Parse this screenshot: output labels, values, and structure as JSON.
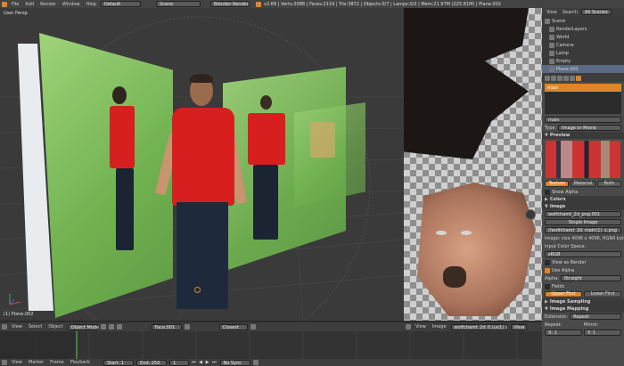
{
  "topbar": {
    "menus": [
      "File",
      "Add",
      "Render",
      "Window",
      "Help"
    ],
    "layout": "Default",
    "scene": "Scene",
    "engine": "Blender Render",
    "all_scenes": "All Scenes",
    "stats": "v2.69 | Verts:2088 | Faces:2119 | Tris:3872 | Objects:0/7 | Lamps:0/2 | Mem:21.97M (225.81M) | Plane.002"
  },
  "viewport": {
    "label": "User Persp",
    "object_label": "(1) Plane.002"
  },
  "viewheader": {
    "menus": [
      "View",
      "Select",
      "Object"
    ],
    "mode": "Object Mode",
    "layer_field": "Face.001",
    "shading": "Closest"
  },
  "uvheader": {
    "menus": [
      "View",
      "Image"
    ],
    "image": "wolfchamt_2d_0 (uv1)_x_png",
    "view": "View"
  },
  "outliner": {
    "tabs": [
      "View",
      "Search",
      "All Scenes"
    ],
    "items": [
      "Scene",
      "RenderLayers",
      "World",
      "Camera",
      "Lamp",
      "Empty",
      "Plane.002"
    ]
  },
  "props": {
    "texture_slot": "main",
    "texture_name": "main",
    "type_label": "Type:",
    "type_value": "Image or Movie",
    "preview_label": "Preview",
    "tabs": [
      "Texture",
      "Material",
      "Both"
    ],
    "show_alpha": "Show Alpha",
    "colors": "Colors",
    "image_label": "Image",
    "image_name": "wolfchamt_2d_png.001",
    "single_image": "Single Image",
    "filepath": "//wolfchamt_2d_main(1)_x.png",
    "info": "Image: size 4096 x 4096, RGBA byte",
    "input_color": "Input Color Space:",
    "color_space": "sRGB",
    "view_render": "View as Render",
    "use_alpha": "Use Alpha",
    "alpha_label": "Alpha:",
    "alpha_value": "Straight",
    "fields": "Fields",
    "interp": [
      "Upper First",
      "Lower First"
    ],
    "sampling": "Image Sampling",
    "mapping": "Image Mapping",
    "extension": "Extension:",
    "extension_value": "Repeat",
    "repeat": "Repeat:",
    "mirror": "Mirror:",
    "x": "X: 1",
    "y": "Y: 1"
  },
  "timeline": {
    "menus": [
      "View",
      "Marker",
      "Frame",
      "Playback"
    ],
    "start": "Start: 1",
    "end": "End: 250",
    "current": "1",
    "sync": "No Sync"
  }
}
